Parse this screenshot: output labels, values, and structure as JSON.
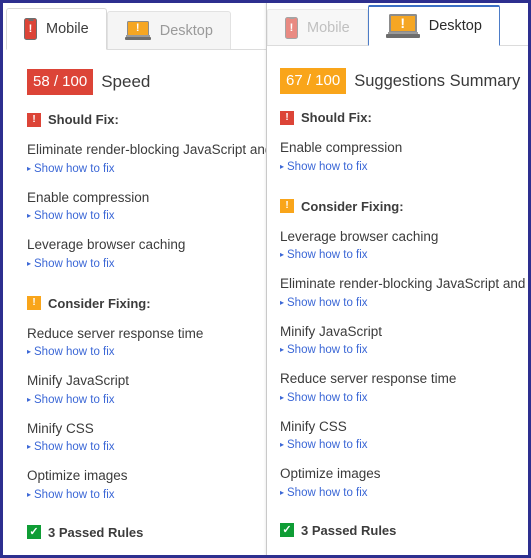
{
  "frame": {
    "border_color": "#2d2f8f"
  },
  "colors": {
    "red": "#dc4437",
    "orange": "#f9a51a",
    "green": "#0f9d35",
    "link_blue": "#3b67d6",
    "active_tab_blue": "#3b6fc4"
  },
  "panels": [
    {
      "id": "mobile-panel",
      "tabs": [
        {
          "label": "Mobile",
          "icon": "mobile-phone-icon",
          "active": true
        },
        {
          "label": "Desktop",
          "icon": "laptop-icon",
          "active": false
        }
      ],
      "score": {
        "badge": "58 / 100",
        "badge_color": "#dc4437",
        "title": "Speed"
      },
      "groups": [
        {
          "label": "Should Fix:",
          "severity": "should-fix",
          "badge_glyph": "!",
          "badge_color": "#dc4437",
          "rules": [
            {
              "title": "Eliminate render-blocking JavaScript and CS",
              "link": "Show how to fix"
            },
            {
              "title": "Enable compression",
              "link": "Show how to fix"
            },
            {
              "title": "Leverage browser caching",
              "link": "Show how to fix"
            }
          ]
        },
        {
          "label": "Consider Fixing:",
          "severity": "consider-fixing",
          "badge_glyph": "!",
          "badge_color": "#f9a51a",
          "rules": [
            {
              "title": "Reduce server response time",
              "link": "Show how to fix"
            },
            {
              "title": "Minify JavaScript",
              "link": "Show how to fix"
            },
            {
              "title": "Minify CSS",
              "link": "Show how to fix"
            },
            {
              "title": "Optimize images",
              "link": "Show how to fix"
            }
          ]
        }
      ],
      "passed": {
        "glyph": "✓",
        "badge_color": "#0f9d35",
        "label": "3 Passed Rules"
      }
    },
    {
      "id": "desktop-panel",
      "tabs": [
        {
          "label": "Mobile",
          "icon": "mobile-phone-icon",
          "active": false
        },
        {
          "label": "Desktop",
          "icon": "laptop-icon",
          "active": true
        }
      ],
      "score": {
        "badge": "67 / 100",
        "badge_color": "#f9a51a",
        "title": "Suggestions Summary"
      },
      "groups": [
        {
          "label": "Should Fix:",
          "severity": "should-fix",
          "badge_glyph": "!",
          "badge_color": "#dc4437",
          "rules": [
            {
              "title": "Enable compression",
              "link": "Show how to fix"
            }
          ]
        },
        {
          "label": "Consider Fixing:",
          "severity": "consider-fixing",
          "badge_glyph": "!",
          "badge_color": "#f9a51a",
          "rules": [
            {
              "title": "Leverage browser caching",
              "link": "Show how to fix"
            },
            {
              "title": "Eliminate render-blocking JavaScript and CSS i",
              "link": "Show how to fix"
            },
            {
              "title": "Minify JavaScript",
              "link": "Show how to fix"
            },
            {
              "title": "Reduce server response time",
              "link": "Show how to fix"
            },
            {
              "title": "Minify CSS",
              "link": "Show how to fix"
            },
            {
              "title": "Optimize images",
              "link": "Show how to fix"
            }
          ]
        }
      ],
      "passed": {
        "glyph": "✓",
        "badge_color": "#0f9d35",
        "label": "3 Passed Rules"
      }
    }
  ]
}
